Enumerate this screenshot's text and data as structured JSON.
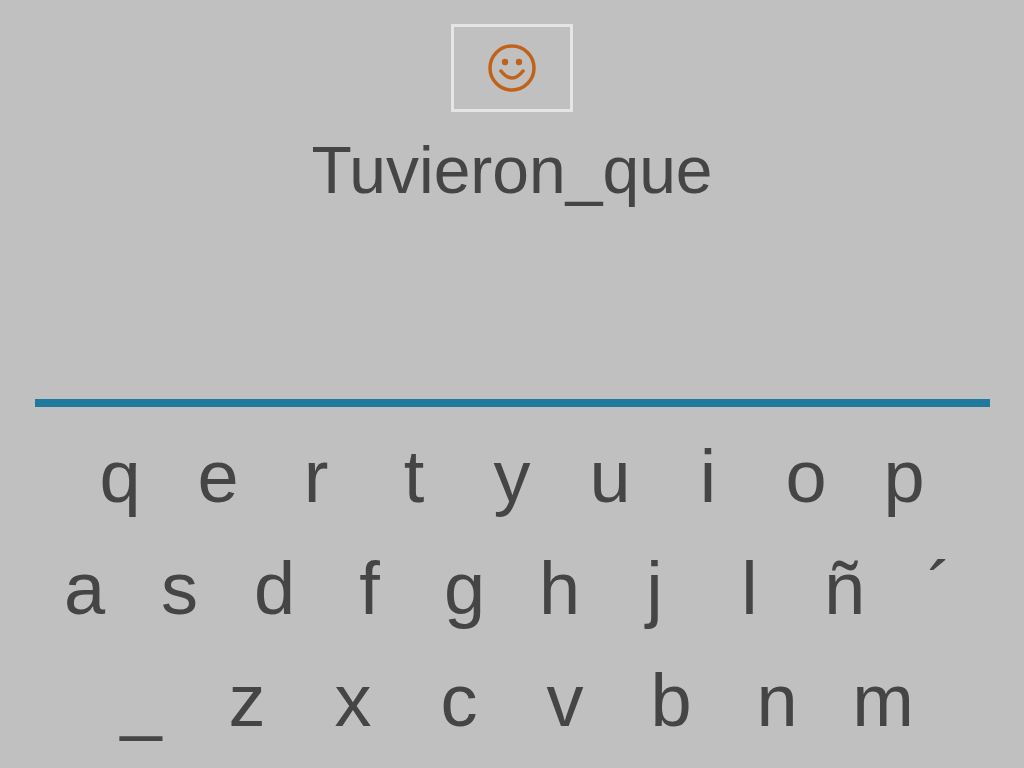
{
  "word": "Tuvieron_que",
  "keyboard": {
    "rows": [
      {
        "keys": [
          "q",
          "e",
          "r",
          "t",
          "y",
          "u",
          "i",
          "o",
          "p"
        ]
      },
      {
        "keys": [
          "a",
          "s",
          "d",
          "f",
          "g",
          "h",
          "j",
          "l",
          "ñ",
          "´"
        ]
      },
      {
        "keys": [
          "_",
          "z",
          "x",
          "c",
          "v",
          "b",
          "n",
          "m"
        ]
      }
    ]
  }
}
